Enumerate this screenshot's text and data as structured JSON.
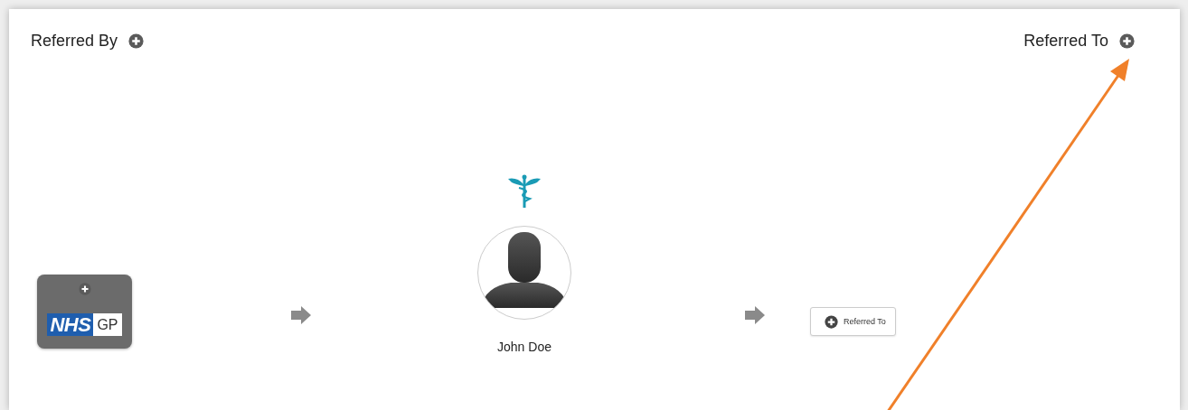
{
  "header": {
    "referred_by": "Referred By",
    "referred_to": "Referred To"
  },
  "source": {
    "logo_main": "NHS",
    "logo_sub": "GP"
  },
  "patient": {
    "name": "John Doe"
  },
  "referral_button": {
    "label": "Referred To"
  }
}
